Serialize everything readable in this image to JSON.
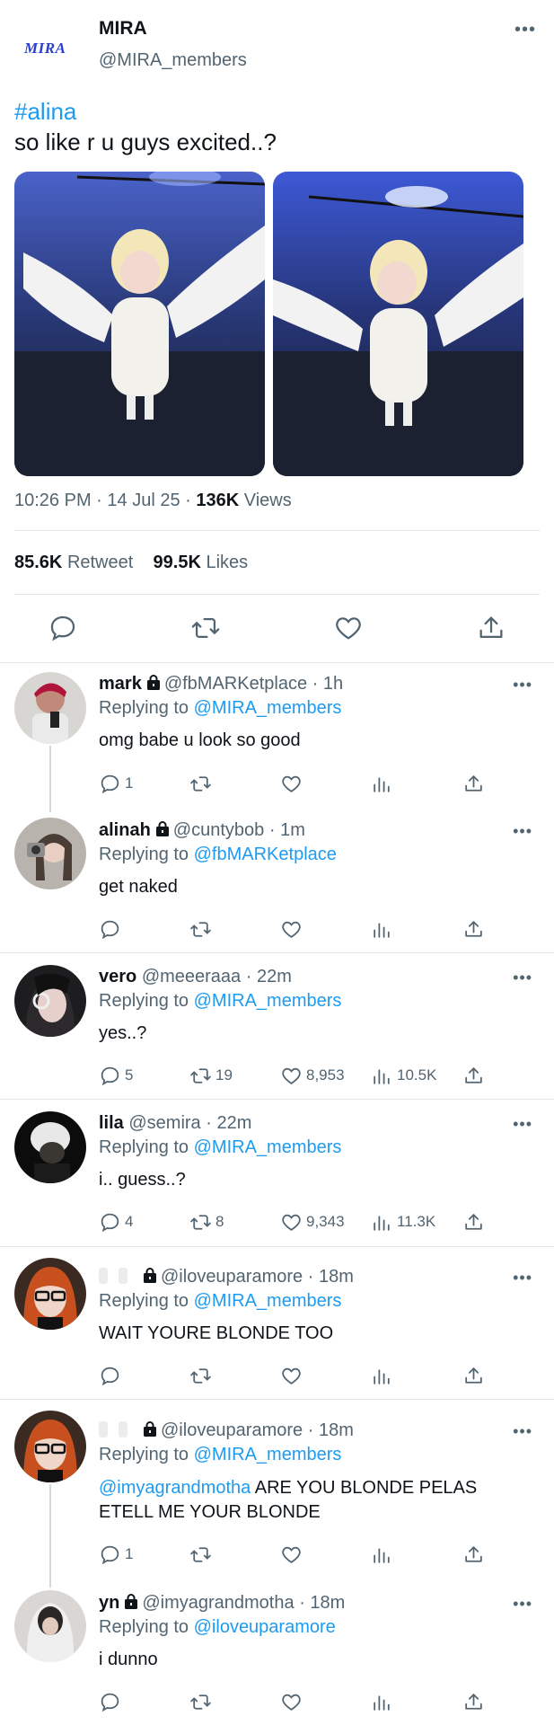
{
  "post": {
    "logo_text": "MIRA",
    "display_name": "MIRA",
    "handle": "@MIRA_members",
    "more": "•••",
    "hashtag": "#alina",
    "text": "so like r u guys excited..?",
    "time": "10:26 PM",
    "date": "14 Jul 25",
    "views_count": "136K",
    "views_label": "Views",
    "retweets_count": "85.6K",
    "retweets_label": "Retweet",
    "likes_count": "99.5K",
    "likes_label": "Likes"
  },
  "replies": [
    {
      "name": "mark",
      "handle": "@fbMARKetplace",
      "time": "1h",
      "locked": true,
      "replying_label": "Replying to",
      "replying_to": "@MIRA_members",
      "text": "omg babe u look so good",
      "reply_count": "1",
      "retweet_count": "",
      "like_count": "",
      "view_count": ""
    },
    {
      "name": "alinah",
      "handle": "@cuntybob",
      "time": "1m",
      "locked": true,
      "replying_label": "Replying to",
      "replying_to": "@fbMARKetplace",
      "text": "get naked",
      "reply_count": "",
      "retweet_count": "",
      "like_count": "",
      "view_count": ""
    },
    {
      "name": "vero",
      "handle": "@meeeraaa",
      "time": "22m",
      "locked": false,
      "replying_label": "Replying to",
      "replying_to": "@MIRA_members",
      "text": "yes..?",
      "reply_count": "5",
      "retweet_count": "19",
      "like_count": "8,953",
      "view_count": "10.5K"
    },
    {
      "name": "lila",
      "handle": "@semira",
      "time": "22m",
      "locked": false,
      "replying_label": "Replying to",
      "replying_to": "@MIRA_members",
      "text": "i.. guess..?",
      "reply_count": "4",
      "retweet_count": "8",
      "like_count": "9,343",
      "view_count": "11.3K"
    },
    {
      "name": "",
      "handle": "@iloveuparamore",
      "time": "18m",
      "locked": true,
      "replying_label": "Replying to",
      "replying_to": "@MIRA_members",
      "text": "WAIT YOURE BLONDE TOO",
      "reply_count": "",
      "retweet_count": "",
      "like_count": "",
      "view_count": ""
    },
    {
      "name": "",
      "handle": "@iloveuparamore",
      "time": "18m",
      "locked": true,
      "replying_label": "Replying to",
      "replying_to": "@MIRA_members",
      "mention": "@imyagrandmotha",
      "text": " ARE YOU BLONDE PELAS ETELL ME YOUR BLONDE",
      "reply_count": "1",
      "retweet_count": "",
      "like_count": "",
      "view_count": ""
    },
    {
      "name": "yn",
      "handle": "@imyagrandmotha",
      "time": "18m",
      "locked": true,
      "replying_label": "Replying to",
      "replying_to": "@iloveuparamore",
      "text": "i dunno",
      "reply_count": "",
      "retweet_count": "",
      "like_count": "",
      "view_count": ""
    }
  ],
  "dot": "·",
  "colors": {
    "accent": "#1d9bf0",
    "muted": "#536471",
    "divider": "#e1e6ea"
  }
}
